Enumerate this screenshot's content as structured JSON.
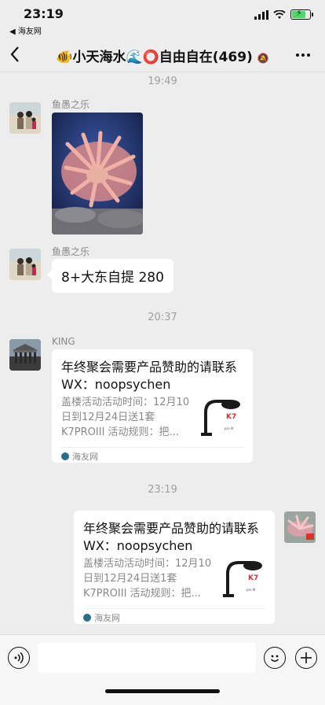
{
  "status_bar": {
    "time": "23:19",
    "back_app": "◀ 海友网"
  },
  "nav": {
    "back_icon": "chevron-left-icon",
    "title": "🐠小天海水🌊⭕自由自在(469)",
    "more_icon": "more-horizontal-icon"
  },
  "messages": [
    {
      "type": "timestamp",
      "text": "19:49"
    },
    {
      "type": "image",
      "side": "left",
      "sender": "鱼愚之乐"
    },
    {
      "type": "text",
      "side": "left",
      "sender": "鱼愚之乐",
      "text": "8+大东自提 280"
    },
    {
      "type": "timestamp",
      "text": "20:37"
    },
    {
      "type": "link_card",
      "side": "left",
      "sender": "KING",
      "title": "年终聚会需要产品赞助的请联系 WX：noopsychen",
      "desc": "盖楼活动活动时间：12月10日到12月24日送1套K7PROIII 活动规则：把...",
      "source": "海友网"
    },
    {
      "type": "timestamp",
      "text": "23:19"
    },
    {
      "type": "link_card",
      "side": "right",
      "title": "年终聚会需要产品赞助的请联系 WX：noopsychen",
      "desc": "盖楼活动活动时间：12月10日到12月24日送1套K7PROIII 活动规则：把...",
      "source": "海友网"
    }
  ],
  "input_bar": {
    "voice_icon": "voice-icon",
    "emoji_icon": "emoji-icon",
    "plus_icon": "plus-icon"
  }
}
